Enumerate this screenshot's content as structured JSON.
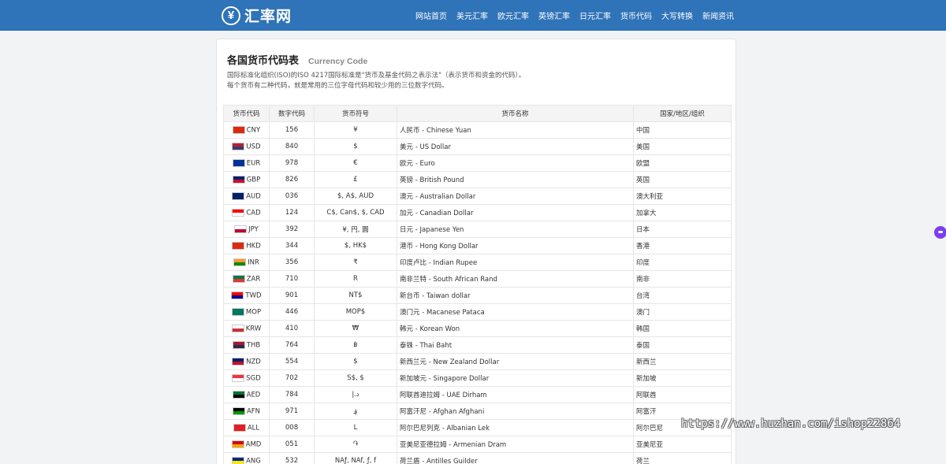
{
  "header": {
    "logo_icon": "¥",
    "logo_text": "汇率网",
    "nav": [
      "网站首页",
      "美元汇率",
      "欧元汇率",
      "英镑汇率",
      "日元汇率",
      "货币代码",
      "大写转换",
      "新闻资讯"
    ]
  },
  "page": {
    "title": "各国货币代码表",
    "subtitle": "Currency Code",
    "desc1": "国际标准化组织(ISO)的ISO 4217国际标准是\"货币及基金代码之表示法\"（表示货币和资金的代码）。",
    "desc2": "每个货币有二种代码，就是常用的三位字母代码和较少用的三位数字代码。"
  },
  "table": {
    "headers": [
      "货币代码",
      "数字代码",
      "货币符号",
      "货币名称",
      "国家/地区/组织"
    ],
    "rows": [
      {
        "code": "CNY",
        "num": "156",
        "sym": "¥",
        "name": "人民币 - Chinese Yuan",
        "country": "中国",
        "flag": [
          "#de2910",
          "#de2910"
        ],
        "flag_icon": "china-flag-icon"
      },
      {
        "code": "USD",
        "num": "840",
        "sym": "$",
        "name": "美元 - US Dollar",
        "country": "美国",
        "flag": [
          "#b22234",
          "#3c3b6e"
        ],
        "flag_icon": "usa-flag-icon"
      },
      {
        "code": "EUR",
        "num": "978",
        "sym": "€",
        "name": "欧元 - Euro",
        "country": "欧盟",
        "flag": [
          "#003399",
          "#003399"
        ],
        "flag_icon": "eu-flag-icon"
      },
      {
        "code": "GBP",
        "num": "826",
        "sym": "£",
        "name": "英镑 - British Pound",
        "country": "英国",
        "flag": [
          "#012169",
          "#c8102e"
        ],
        "flag_icon": "uk-flag-icon"
      },
      {
        "code": "AUD",
        "num": "036",
        "sym": "$, A$, AUD",
        "name": "澳元 - Australian Dollar",
        "country": "澳大利亚",
        "flag": [
          "#012169",
          "#012169"
        ],
        "flag_icon": "australia-flag-icon"
      },
      {
        "code": "CAD",
        "num": "124",
        "sym": "C$, Can$, $, CAD",
        "name": "加元 - Canadian Dollar",
        "country": "加拿大",
        "flag": [
          "#ff0000",
          "#ffffff"
        ],
        "flag_icon": "canada-flag-icon"
      },
      {
        "code": "JPY",
        "num": "392",
        "sym": "¥, 円, 圓",
        "name": "日元 - Japanese Yen",
        "country": "日本",
        "flag": [
          "#ffffff",
          "#bc002d"
        ],
        "flag_icon": "japan-flag-icon"
      },
      {
        "code": "HKD",
        "num": "344",
        "sym": "$, HK$",
        "name": "港币 - Hong Kong Dollar",
        "country": "香港",
        "flag": [
          "#de2910",
          "#de2910"
        ],
        "flag_icon": "hongkong-flag-icon"
      },
      {
        "code": "INR",
        "num": "356",
        "sym": "₹",
        "name": "印度卢比 - Indian Rupee",
        "country": "印度",
        "flag": [
          "#ff9933",
          "#138808"
        ],
        "flag_icon": "india-flag-icon"
      },
      {
        "code": "ZAR",
        "num": "710",
        "sym": "R",
        "name": "南非兰特 - South African Rand",
        "country": "南非",
        "flag": [
          "#007a4d",
          "#de3831"
        ],
        "flag_icon": "southafrica-flag-icon"
      },
      {
        "code": "TWD",
        "num": "901",
        "sym": "NT$",
        "name": "新台币 - Taiwan dollar",
        "country": "台湾",
        "flag": [
          "#fe0000",
          "#000095"
        ],
        "flag_icon": "taiwan-flag-icon"
      },
      {
        "code": "MOP",
        "num": "446",
        "sym": "MOP$",
        "name": "澳门元 - Macanese Pataca",
        "country": "澳门",
        "flag": [
          "#00785e",
          "#00785e"
        ],
        "flag_icon": "macau-flag-icon"
      },
      {
        "code": "KRW",
        "num": "410",
        "sym": "₩",
        "name": "韩元 - Korean Won",
        "country": "韩国",
        "flag": [
          "#ffffff",
          "#cd2e3a"
        ],
        "flag_icon": "korea-flag-icon"
      },
      {
        "code": "THB",
        "num": "764",
        "sym": "฿",
        "name": "泰铢 - Thai Baht",
        "country": "泰国",
        "flag": [
          "#a51931",
          "#2d2a4a"
        ],
        "flag_icon": "thailand-flag-icon"
      },
      {
        "code": "NZD",
        "num": "554",
        "sym": "$",
        "name": "新西兰元 - New Zealand Dollar",
        "country": "新西兰",
        "flag": [
          "#012169",
          "#c8102e"
        ],
        "flag_icon": "newzealand-flag-icon"
      },
      {
        "code": "SGD",
        "num": "702",
        "sym": "S$, $",
        "name": "新加坡元 - Singapore Dollar",
        "country": "新加坡",
        "flag": [
          "#ef3340",
          "#ffffff"
        ],
        "flag_icon": "singapore-flag-icon"
      },
      {
        "code": "AED",
        "num": "784",
        "sym": "د.إ",
        "name": "阿联酋迪拉姆 - UAE Dirham",
        "country": "阿联酋",
        "flag": [
          "#00732f",
          "#000000"
        ],
        "flag_icon": "uae-flag-icon"
      },
      {
        "code": "AFN",
        "num": "971",
        "sym": "؋",
        "name": "阿富汗尼 - Afghan Afghani",
        "country": "阿富汗",
        "flag": [
          "#000000",
          "#009900"
        ],
        "flag_icon": "afghanistan-flag-icon"
      },
      {
        "code": "ALL",
        "num": "008",
        "sym": "L",
        "name": "阿尔巴尼列克 - Albanian Lek",
        "country": "阿尔巴尼",
        "flag": [
          "#e41e20",
          "#e41e20"
        ],
        "flag_icon": "albania-flag-icon"
      },
      {
        "code": "AMD",
        "num": "051",
        "sym": "֏",
        "name": "亚美尼亚德拉姆 - Armenian Dram",
        "country": "亚美尼亚",
        "flag": [
          "#d90012",
          "#f2a800"
        ],
        "flag_icon": "armenia-flag-icon"
      },
      {
        "code": "ANG",
        "num": "532",
        "sym": "NAƒ, NAf, ƒ, f",
        "name": "荷兰盾 - Antilles Guilder",
        "country": "荷兰",
        "flag": [
          "#002b7f",
          "#f9e814"
        ],
        "flag_icon": "antilles-flag-icon"
      }
    ]
  },
  "watermark": "https://www.huzhan.com/ishop22864"
}
